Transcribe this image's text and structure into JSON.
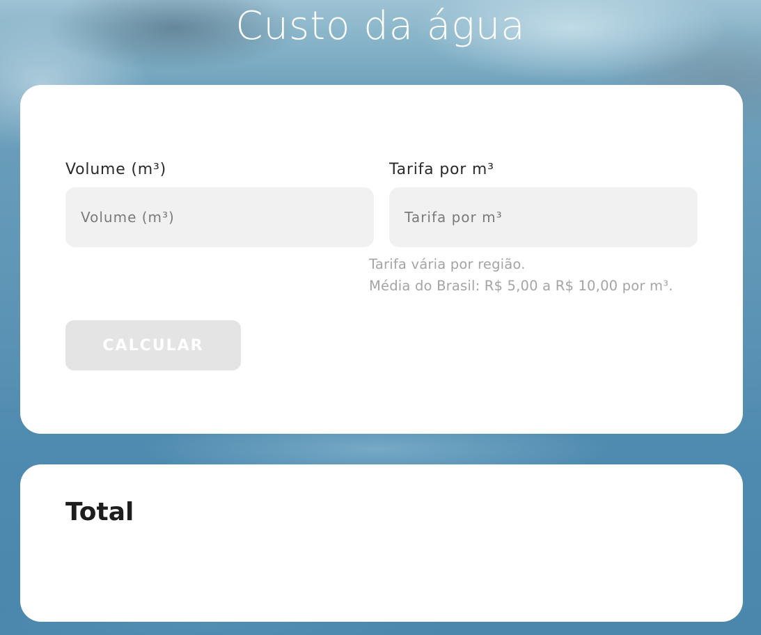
{
  "header": {
    "title": "Custo da água"
  },
  "form": {
    "volume": {
      "label": "Volume (m³)",
      "placeholder": "Volume (m³)",
      "value": ""
    },
    "tariff": {
      "label": "Tarifa por m³",
      "placeholder": "Tarifa por m³",
      "value": ""
    },
    "hint": {
      "line1": "Tarifa vária por região.",
      "line2": "Média do Brasil: R$ 5,00 a R$ 10,00 por m³."
    },
    "calculate_label": "CALCULAR"
  },
  "result": {
    "title": "Total",
    "value": ""
  },
  "colors": {
    "card": "#ffffff",
    "input_bg": "#f1f1f1",
    "button_disabled": "#e4e4e4",
    "hint_text": "#a4a4a4"
  }
}
